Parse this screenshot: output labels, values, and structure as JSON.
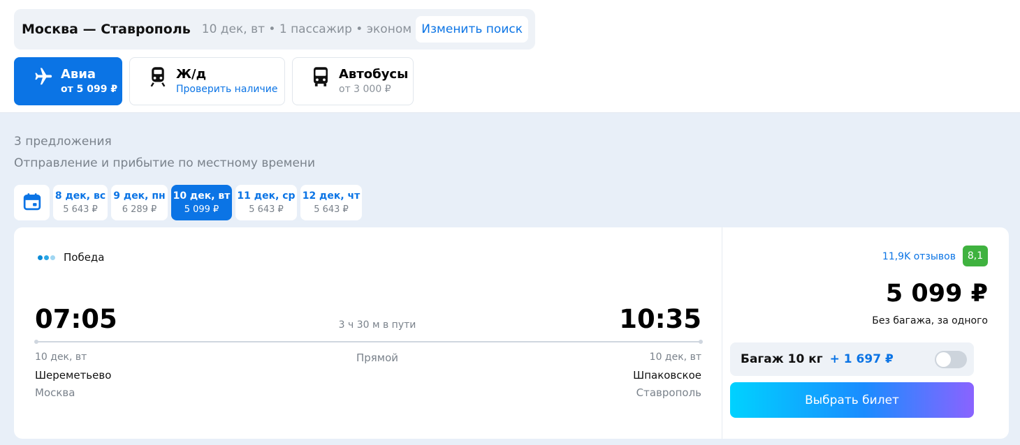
{
  "search": {
    "route": "Москва — Ставрополь",
    "details": "10 дек, вт • 1 пассажир • эконом",
    "change_label": "Изменить поиск"
  },
  "modes": [
    {
      "title": "Авиа",
      "subtitle": "от 5 099 ₽",
      "icon": "plane-icon",
      "active": true
    },
    {
      "title": "Ж/д",
      "subtitle": "Проверить наличие",
      "icon": "train-icon",
      "active": false
    },
    {
      "title": "Автобусы",
      "subtitle": "от 3 000 ₽",
      "icon": "bus-icon",
      "active": false
    }
  ],
  "results": {
    "count_label": "3 предложения",
    "time_note": "Отправление и прибытие по местному времени"
  },
  "dates": [
    {
      "label": "8 дек, вс",
      "price": "5 643 ₽",
      "active": false
    },
    {
      "label": "9 дек, пн",
      "price": "6 289 ₽",
      "active": false
    },
    {
      "label": "10 дек, вт",
      "price": "5 099 ₽",
      "active": true
    },
    {
      "label": "11 дек, ср",
      "price": "5 643 ₽",
      "active": false
    },
    {
      "label": "12 дек, чт",
      "price": "5 643 ₽",
      "active": false
    }
  ],
  "flight": {
    "airline": "Победа",
    "airline_colors": [
      "#0b8ad6",
      "#2aa7e6",
      "#9fd6f2"
    ],
    "departure": {
      "time": "07:05",
      "date": "10 дек, вт",
      "airport": "Шереметьево",
      "city": "Москва"
    },
    "arrival": {
      "time": "10:35",
      "date": "10 дек, вт",
      "airport": "Шпаковское",
      "city": "Ставрополь"
    },
    "duration": "3 ч 30 м в пути",
    "transfer": "Прямой"
  },
  "offer": {
    "reviews": "11,9K отзывов",
    "rating": "8,1",
    "price": "5 099 ₽",
    "price_note": "Без багажа, за одного",
    "baggage_label": "Багаж 10 кг",
    "baggage_price": "+ 1 697 ₽",
    "baggage_enabled": false,
    "select_label": "Выбрать билет"
  },
  "colors": {
    "accent": "#0b74e5",
    "rating_bg": "#3fb23f",
    "background": "#e8eff8"
  }
}
